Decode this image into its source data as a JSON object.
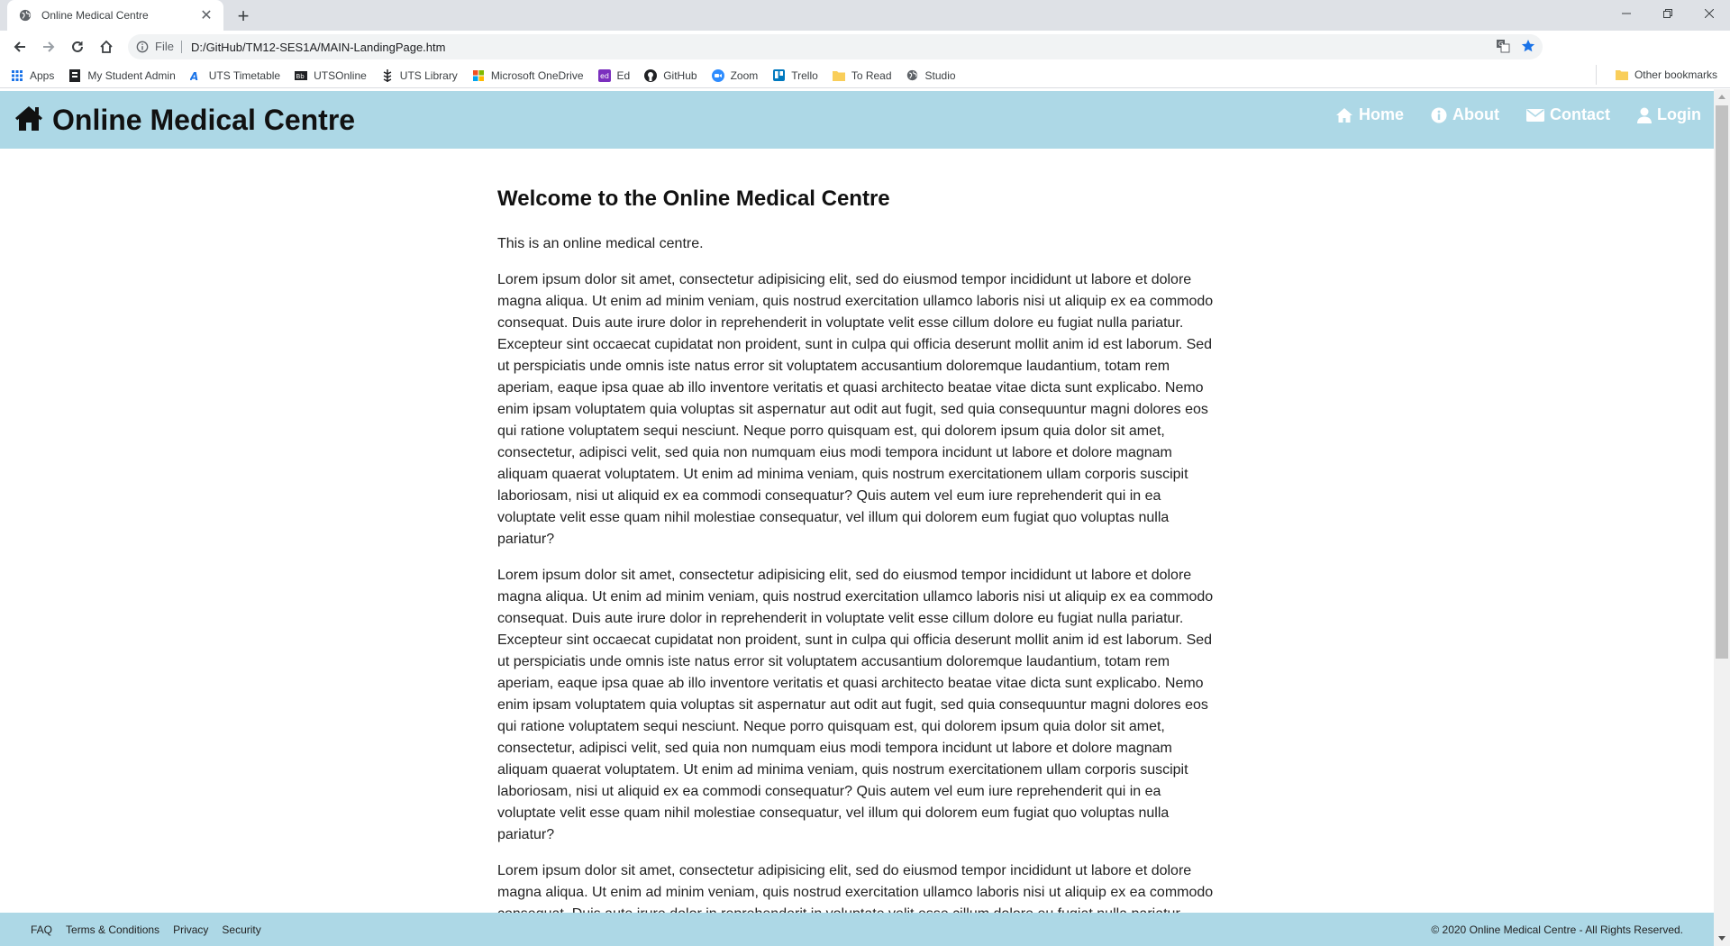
{
  "browser": {
    "tab_title": "Online Medical Centre",
    "omnibox": {
      "scheme": "File",
      "url": "D:/GitHub/TM12-SES1A/MAIN-LandingPage.htm"
    },
    "bookmarks": [
      {
        "label": "Apps",
        "icon": "apps-grid-icon",
        "color": "#1a73e8"
      },
      {
        "label": "My Student Admin",
        "icon": "student-admin-icon",
        "color": "#202124"
      },
      {
        "label": "UTS Timetable",
        "icon": "timetable-icon",
        "color": "#1a73e8"
      },
      {
        "label": "UTSOnline",
        "icon": "blackboard-icon",
        "color": "#202124"
      },
      {
        "label": "UTS Library",
        "icon": "library-icon",
        "color": "#202124"
      },
      {
        "label": "Microsoft OneDrive",
        "icon": "microsoft-icon",
        "color": "#f25022"
      },
      {
        "label": "Ed",
        "icon": "ed-icon",
        "color": "#7b2fbe"
      },
      {
        "label": "GitHub",
        "icon": "github-icon",
        "color": "#202124"
      },
      {
        "label": "Zoom",
        "icon": "zoom-icon",
        "color": "#2d8cff"
      },
      {
        "label": "Trello",
        "icon": "trello-icon",
        "color": "#0079bf"
      },
      {
        "label": "To Read",
        "icon": "folder-icon",
        "color": "#f9ce5a"
      },
      {
        "label": "Studio",
        "icon": "globe-icon",
        "color": "#5f6368"
      }
    ],
    "other_bookmarks": "Other bookmarks"
  },
  "site": {
    "brand_title": "Online Medical Centre",
    "header_color": "#add8e6",
    "nav": [
      {
        "label": "Home",
        "icon": "home-icon"
      },
      {
        "label": "About",
        "icon": "info-icon"
      },
      {
        "label": "Contact",
        "icon": "envelope-icon"
      },
      {
        "label": "Login",
        "icon": "user-icon"
      }
    ],
    "heading": "Welcome to the Online Medical Centre",
    "intro": "This is an online medical centre.",
    "paragraphs": [
      "Lorem ipsum dolor sit amet, consectetur adipisicing elit, sed do eiusmod tempor incididunt ut labore et dolore magna aliqua. Ut enim ad minim veniam, quis nostrud exercitation ullamco laboris nisi ut aliquip ex ea commodo consequat. Duis aute irure dolor in reprehenderit in voluptate velit esse cillum dolore eu fugiat nulla pariatur. Excepteur sint occaecat cupidatat non proident, sunt in culpa qui officia deserunt mollit anim id est laborum. Sed ut perspiciatis unde omnis iste natus error sit voluptatem accusantium doloremque laudantium, totam rem aperiam, eaque ipsa quae ab illo inventore veritatis et quasi architecto beatae vitae dicta sunt explicabo. Nemo enim ipsam voluptatem quia voluptas sit aspernatur aut odit aut fugit, sed quia consequuntur magni dolores eos qui ratione voluptatem sequi nesciunt. Neque porro quisquam est, qui dolorem ipsum quia dolor sit amet, consectetur, adipisci velit, sed quia non numquam eius modi tempora incidunt ut labore et dolore magnam aliquam quaerat voluptatem. Ut enim ad minima veniam, quis nostrum exercitationem ullam corporis suscipit laboriosam, nisi ut aliquid ex ea commodi consequatur? Quis autem vel eum iure reprehenderit qui in ea voluptate velit esse quam nihil molestiae consequatur, vel illum qui dolorem eum fugiat quo voluptas nulla pariatur?",
      "Lorem ipsum dolor sit amet, consectetur adipisicing elit, sed do eiusmod tempor incididunt ut labore et dolore magna aliqua. Ut enim ad minim veniam, quis nostrud exercitation ullamco laboris nisi ut aliquip ex ea commodo consequat. Duis aute irure dolor in reprehenderit in voluptate velit esse cillum dolore eu fugiat nulla pariatur. Excepteur sint occaecat cupidatat non proident, sunt in culpa qui officia deserunt mollit anim id est laborum. Sed ut perspiciatis unde omnis iste natus error sit voluptatem accusantium doloremque laudantium, totam rem aperiam, eaque ipsa quae ab illo inventore veritatis et quasi architecto beatae vitae dicta sunt explicabo. Nemo enim ipsam voluptatem quia voluptas sit aspernatur aut odit aut fugit, sed quia consequuntur magni dolores eos qui ratione voluptatem sequi nesciunt. Neque porro quisquam est, qui dolorem ipsum quia dolor sit amet, consectetur, adipisci velit, sed quia non numquam eius modi tempora incidunt ut labore et dolore magnam aliquam quaerat voluptatem. Ut enim ad minima veniam, quis nostrum exercitationem ullam corporis suscipit laboriosam, nisi ut aliquid ex ea commodi consequatur? Quis autem vel eum iure reprehenderit qui in ea voluptate velit esse quam nihil molestiae consequatur, vel illum qui dolorem eum fugiat quo voluptas nulla pariatur?",
      "Lorem ipsum dolor sit amet, consectetur adipisicing elit, sed do eiusmod tempor incididunt ut labore et dolore magna aliqua. Ut enim ad minim veniam, quis nostrud exercitation ullamco laboris nisi ut aliquip ex ea commodo consequat. Duis aute irure dolor in reprehenderit in voluptate velit esse cillum dolore eu fugiat nulla pariatur."
    ],
    "footer": {
      "links": [
        "FAQ",
        "Terms & Conditions",
        "Privacy",
        "Security"
      ],
      "copyright": "© 2020 Online Medical Centre - All Rights Reserved."
    }
  }
}
